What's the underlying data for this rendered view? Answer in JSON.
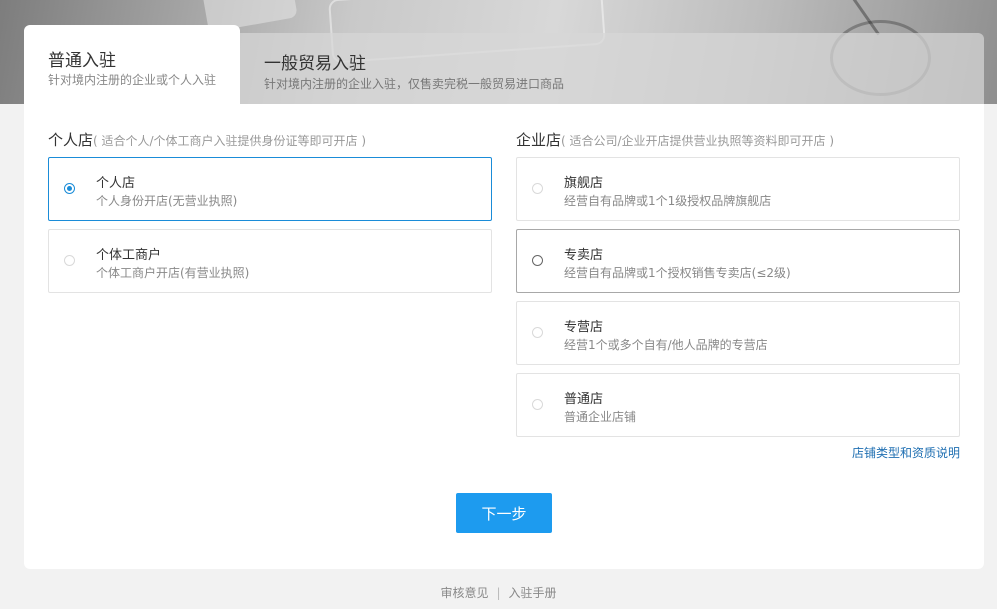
{
  "tabs": [
    {
      "title": "普通入驻",
      "subtitle": "针对境内注册的企业或个人入驻",
      "active": true
    },
    {
      "title": "一般贸易入驻",
      "subtitle": "针对境内注册的企业入驻，仅售卖完税一般贸易进口商品",
      "active": false
    }
  ],
  "personal": {
    "title": "个人店",
    "hint": "( 适合个人/个体工商户入驻提供身份证等即可开店 )",
    "options": [
      {
        "title": "个人店",
        "desc": "个人身份开店(无营业执照)",
        "selected": true
      },
      {
        "title": "个体工商户",
        "desc": "个体工商户开店(有营业执照)",
        "selected": false
      }
    ]
  },
  "enterprise": {
    "title": "企业店",
    "hint": "( 适合公司/企业开店提供营业执照等资料即可开店 )",
    "options": [
      {
        "title": "旗舰店",
        "desc": "经营自有品牌或1个1级授权品牌旗舰店",
        "selected": false
      },
      {
        "title": "专卖店",
        "desc": "经营自有品牌或1个授权销售专卖店(≤2级)",
        "selected": false
      },
      {
        "title": "专营店",
        "desc": "经营1个或多个自有/他人品牌的专营店",
        "selected": false
      },
      {
        "title": "普通店",
        "desc": "普通企业店铺",
        "selected": false
      }
    ],
    "help_link": "店铺类型和资质说明"
  },
  "next_button": "下一步",
  "footer": {
    "links": [
      "审核意见",
      "入驻手册"
    ],
    "separator": "|"
  },
  "colors": {
    "accent": "#1d9bef",
    "selected_border": "#1a8cd8",
    "link": "#1f6fb2"
  }
}
